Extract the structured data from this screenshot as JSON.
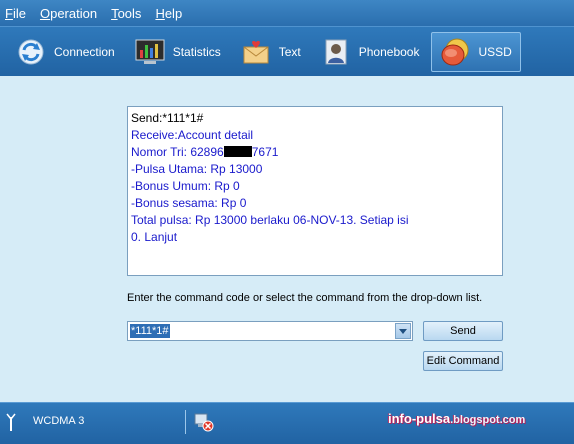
{
  "menu": {
    "items": [
      {
        "accel": "F",
        "rest": "ile"
      },
      {
        "accel": "O",
        "rest": "peration"
      },
      {
        "accel": "T",
        "rest": "ools"
      },
      {
        "accel": "H",
        "rest": "elp"
      }
    ]
  },
  "toolbar": {
    "connection": "Connection",
    "statistics": "Statistics",
    "text": "Text",
    "phonebook": "Phonebook",
    "ussd": "USSD",
    "active": "ussd"
  },
  "response": {
    "sent": "Send:*111*1#",
    "receive": "Receive:Account detail",
    "nomor_prefix": "Nomor Tri: 62896",
    "nomor_suffix": "7671",
    "pulsa_utama": "-Pulsa Utama: Rp 13000",
    "bonus_umum": "-Bonus Umum: Rp 0",
    "bonus_sesama": "-Bonus sesama: Rp 0",
    "total": "Total pulsa: Rp 13000 berlaku 06-NOV-13. Setiap isi",
    "lanjut": "0. Lanjut"
  },
  "hint": "Enter the command code or select the command from the drop-down list.",
  "command": {
    "value": "*111*1#",
    "send_label": "Send",
    "edit_label": "Edit Command"
  },
  "status": {
    "network": "WCDMA  3",
    "watermark_main": "info-pulsa",
    "watermark_blog": ".blogspot.com"
  },
  "colors": {
    "bar": "#2a6eae",
    "main_bg": "#d6ecf7",
    "response_text": "#1a1acc"
  }
}
